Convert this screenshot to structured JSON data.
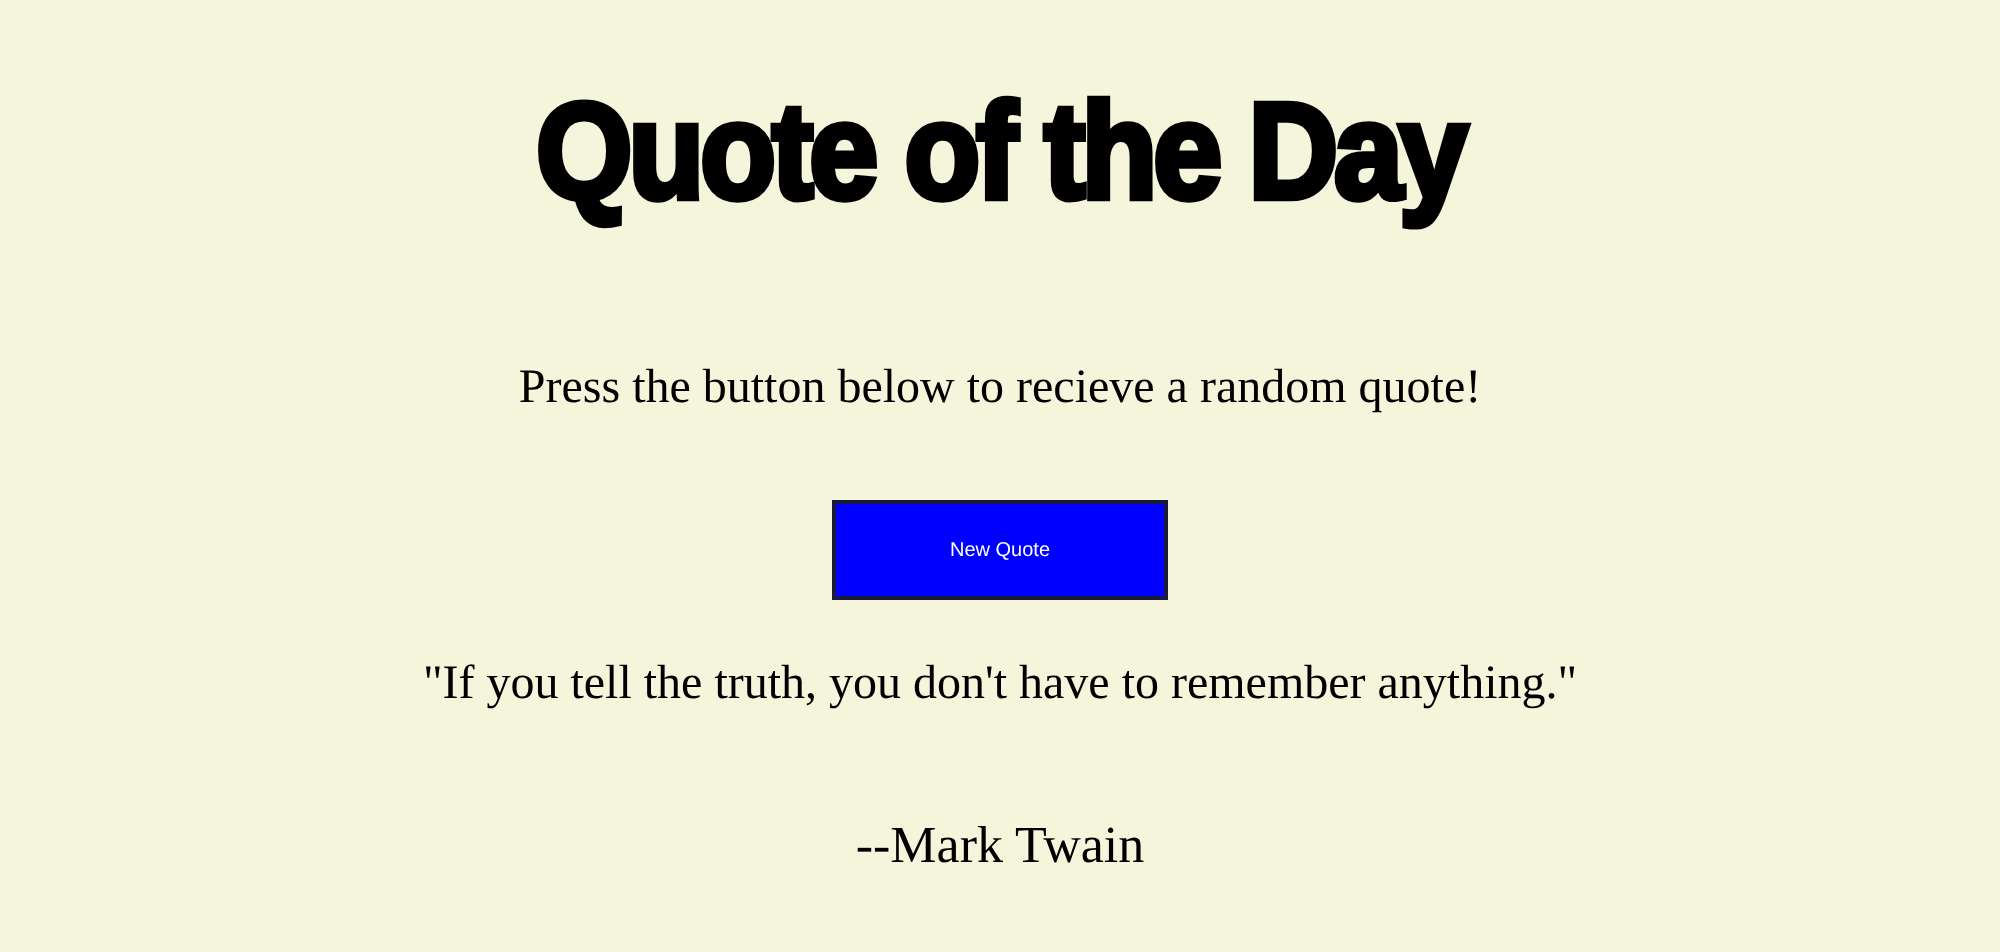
{
  "heading": "Quote of the Day",
  "instruction": "Press the button below to recieve a random quote!",
  "button": {
    "label": "New Quote"
  },
  "quote": {
    "text": "\"If you tell the truth, you don't have to remember anything.\"",
    "author": "--Mark Twain"
  }
}
